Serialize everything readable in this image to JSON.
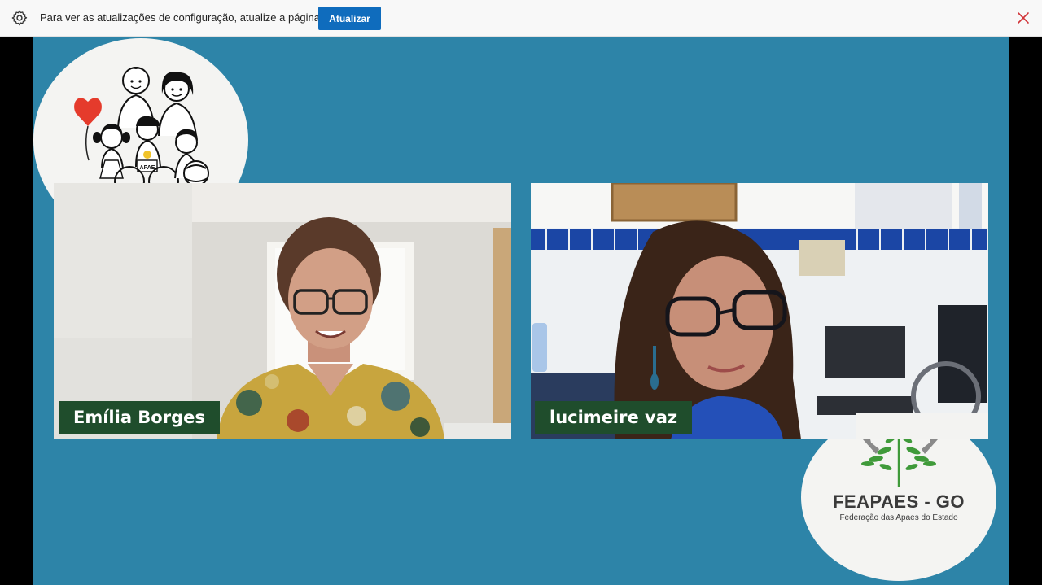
{
  "notification": {
    "message": "Para ver as atualizações de configuração, atualize a página",
    "refresh_label": "Atualizar",
    "accent_color": "#0f6cbd",
    "close_color": "#d13438"
  },
  "stage": {
    "background_color": "#2d84a8"
  },
  "participants": [
    {
      "name": "Emília Borges"
    },
    {
      "name": "lucimeire vaz"
    }
  ],
  "logos": {
    "apae_badge": "APAE",
    "feapaes_title": "FEAPAES - GO",
    "feapaes_subtitle": "Federação das Apaes do Estado"
  },
  "icons": {
    "settings": "gear-icon",
    "close": "close-icon"
  }
}
